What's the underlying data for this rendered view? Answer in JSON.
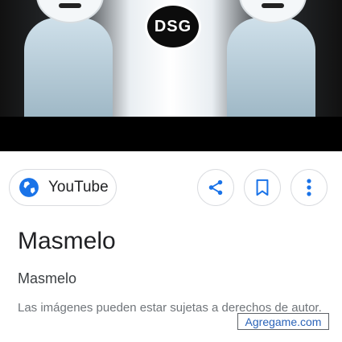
{
  "hero": {
    "logo_text": "DSG"
  },
  "source_chip": {
    "label": "YouTube",
    "icon": "globe-icon"
  },
  "actions": {
    "share_icon": "share-icon",
    "save_icon": "bookmark-icon",
    "more_icon": "more-vert-icon"
  },
  "info": {
    "title": "Masmelo",
    "subtitle": "Masmelo",
    "disclaimer": "Las imágenes pueden estar sujetas a derechos de autor."
  },
  "watermark": "Agregame.com",
  "colors": {
    "accent_blue": "#1a73e8",
    "icon_blue": "#1a73e8"
  }
}
